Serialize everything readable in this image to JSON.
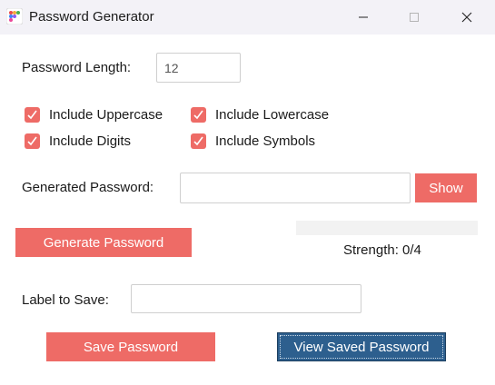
{
  "window": {
    "title": "Password Generator",
    "controls": {
      "minimize": "minimize-icon",
      "maximize": "maximize-icon",
      "close": "close-icon"
    }
  },
  "length": {
    "label": "Password Length:",
    "value": "12"
  },
  "options": [
    {
      "label": "Include Uppercase",
      "checked": true
    },
    {
      "label": "Include Lowercase",
      "checked": true
    },
    {
      "label": "Include Digits",
      "checked": true
    },
    {
      "label": "Include Symbols",
      "checked": true
    }
  ],
  "generated": {
    "label": "Generated Password:",
    "value": "",
    "show_label": "Show"
  },
  "generate_label": "Generate Password",
  "strength": {
    "text": "Strength: 0/4",
    "score": 0,
    "max": 4
  },
  "save": {
    "label": "Label to Save:",
    "value": ""
  },
  "save_button": "Save Password",
  "view_button": "View Saved Password",
  "colors": {
    "accent": "#ee6b66",
    "primary": "#2d5f8e",
    "titlebar": "#f3f2f7"
  }
}
